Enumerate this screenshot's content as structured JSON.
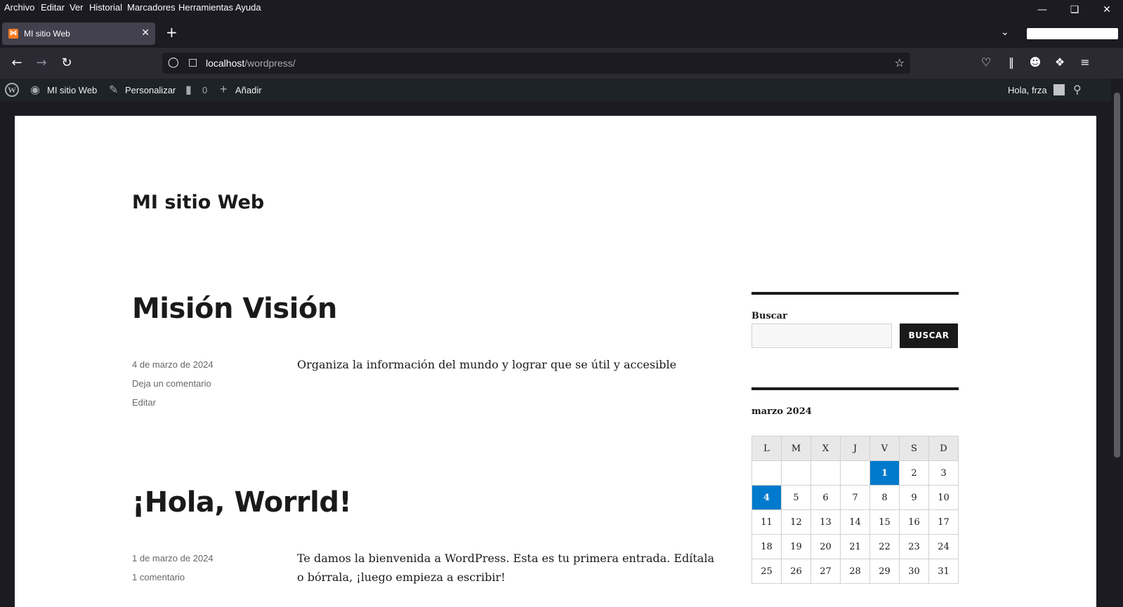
{
  "menu": [
    "Archivo",
    "Editar",
    "Ver",
    "Historial",
    "Marcadores",
    "Herramientas",
    "Ayuda"
  ],
  "tab": {
    "title": "MI sitio Web",
    "favicon": "xampp-icon"
  },
  "url": {
    "host": "localhost",
    "path": "/wordpress/"
  },
  "wpbar": {
    "site": "MI sitio Web",
    "customize": "Personalizar",
    "comments": "0",
    "new": "Añadir",
    "greeting": "Hola, frza"
  },
  "site_title": "MI sitio Web",
  "posts": [
    {
      "title": "Misión Visión",
      "date": "4 de marzo de 2024",
      "comment": "Deja un comentario",
      "edit": "Editar",
      "content": "Organiza la información del mundo y lograr que se útil y accesible"
    },
    {
      "title": "¡Hola, Worrld!",
      "date": "1 de marzo de 2024",
      "comment": "1 comentario",
      "content": "Te damos la bienvenida a WordPress. Esta es tu primera entrada. Edítala o bórrala, ¡luego empieza a escribir!"
    }
  ],
  "sidebar": {
    "search_label": "Buscar",
    "search_button": "BUSCAR",
    "calendar_caption": "marzo 2024",
    "weekdays": [
      "L",
      "M",
      "X",
      "J",
      "V",
      "S",
      "D"
    ],
    "weeks": [
      [
        "",
        "",
        "",
        "",
        "1",
        "2",
        "3"
      ],
      [
        "4",
        "5",
        "6",
        "7",
        "8",
        "9",
        "10"
      ],
      [
        "11",
        "12",
        "13",
        "14",
        "15",
        "16",
        "17"
      ],
      [
        "18",
        "19",
        "20",
        "21",
        "22",
        "23",
        "24"
      ],
      [
        "25",
        "26",
        "27",
        "28",
        "29",
        "30",
        "31"
      ]
    ],
    "highlighted_days": [
      "1",
      "4"
    ]
  },
  "colors": {
    "accent": "#007acc",
    "admin_bar": "#1d2327"
  }
}
